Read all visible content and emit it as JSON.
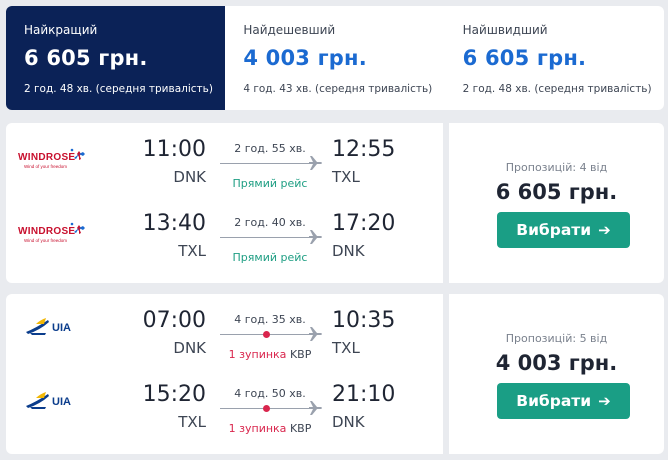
{
  "sort_tabs": [
    {
      "label": "Найкращий",
      "price": "6 605 грн.",
      "duration": "2 год. 48 хв. (середня тривалість)"
    },
    {
      "label": "Найдешевший",
      "price": "4 003 грн.",
      "duration": "4 год. 43 хв. (середня тривалість)"
    },
    {
      "label": "Найшвидший",
      "price": "6 605 грн.",
      "duration": "2 год. 48 хв. (середня тривалість)"
    }
  ],
  "results": [
    {
      "airline_logo": "windrose-logo",
      "segments": [
        {
          "dep_time": "11:00",
          "dep_code": "DNK",
          "duration": "2 год. 55 хв.",
          "stops": "Прямий рейс",
          "arr_time": "12:55",
          "arr_code": "TXL"
        },
        {
          "dep_time": "13:40",
          "dep_code": "TXL",
          "duration": "2 год. 40 хв.",
          "stops": "Прямий рейс",
          "arr_time": "17:20",
          "arr_code": "DNK"
        }
      ],
      "offers": "Пропозицій: 4 від",
      "price": "6 605 грн.",
      "button": "Вибрати"
    },
    {
      "airline_logo": "uia-logo",
      "segments": [
        {
          "dep_time": "07:00",
          "dep_code": "DNK",
          "duration": "4 год. 35 хв.",
          "stops": "1 зупинка",
          "stop_airport": "KBP",
          "arr_time": "10:35",
          "arr_code": "TXL"
        },
        {
          "dep_time": "15:20",
          "dep_code": "TXL",
          "duration": "4 год. 50 хв.",
          "stops": "1 зупинка",
          "stop_airport": "KBP",
          "arr_time": "21:10",
          "arr_code": "DNK"
        }
      ],
      "offers": "Пропозицій: 5 від",
      "price": "4 003 грн.",
      "button": "Вибрати"
    }
  ],
  "colors": {
    "active_tab": "#0b2257",
    "price_link": "#1b6ad1",
    "select_button": "#1a9e85",
    "direct_flight": "#1e9e83",
    "stop": "#d9264d",
    "windrose_red": "#c8102e",
    "uia_blue": "#0b3d8c",
    "uia_yellow": "#f2b705"
  }
}
